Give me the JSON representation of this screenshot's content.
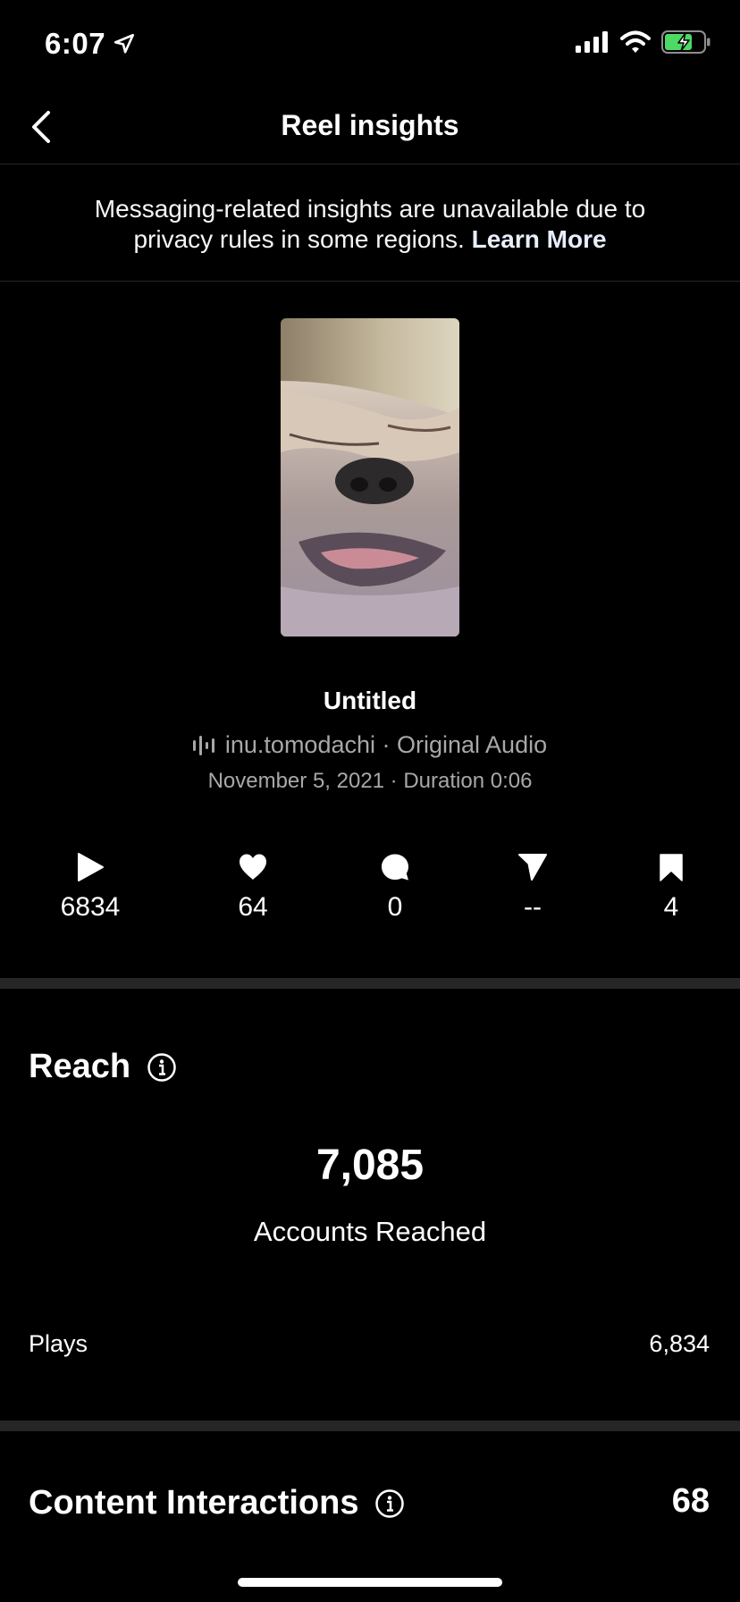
{
  "status": {
    "time": "6:07"
  },
  "nav": {
    "title": "Reel insights"
  },
  "notice": {
    "text": "Messaging-related insights are unavailable due to privacy rules in some regions.",
    "link": "Learn More"
  },
  "reel": {
    "title": "Untitled",
    "audio_user": "inu.tomodachi",
    "audio_sep": " · ",
    "audio_name": "Original Audio",
    "meta": "November 5, 2021 · Duration 0:06"
  },
  "metrics": {
    "plays": "6834",
    "likes": "64",
    "comments": "0",
    "shares": "--",
    "saves": "4"
  },
  "reach": {
    "title": "Reach",
    "value": "7,085",
    "label": "Accounts Reached",
    "plays_label": "Plays",
    "plays_value": "6,834"
  },
  "interactions": {
    "title": "Content Interactions",
    "value": "68"
  },
  "icons": [
    "location-arrow-icon",
    "signal-icon",
    "wifi-icon",
    "battery-charging-icon",
    "back-chevron-icon",
    "audio-bars-icon",
    "play-icon",
    "heart-icon",
    "comment-icon",
    "send-icon",
    "bookmark-icon",
    "info-icon"
  ],
  "colors": {
    "background": "#000000",
    "secondary_text": "#a8a8a8",
    "divider": "#262626",
    "battery": "#4cd964"
  }
}
